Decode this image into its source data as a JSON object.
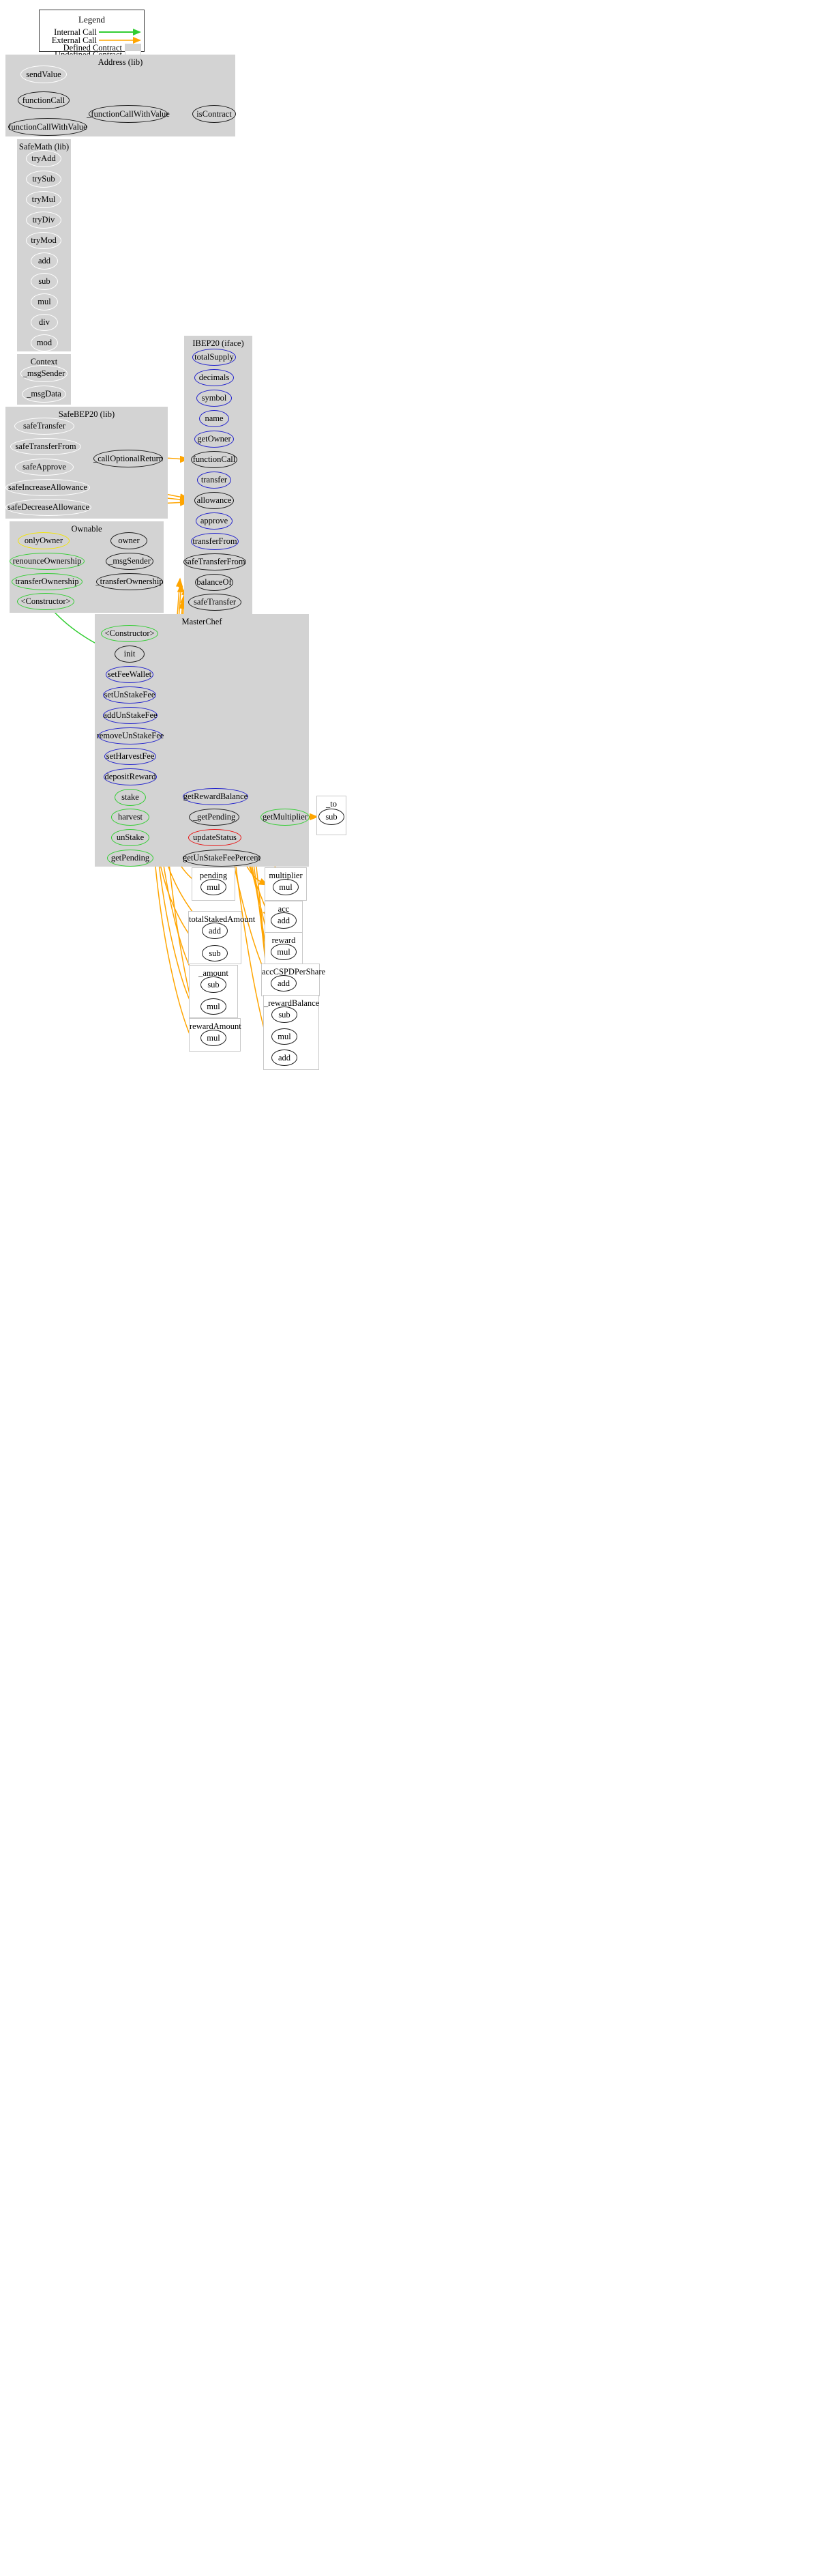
{
  "legend": {
    "title": "Legend",
    "rows": [
      {
        "label": "Internal Call",
        "kind": "arrow",
        "color": "#32cd32"
      },
      {
        "label": "External Call",
        "kind": "arrow",
        "color": "#ffa500"
      },
      {
        "label": "Defined Contract",
        "kind": "swatch-filled",
        "color": "#d3d3d3"
      },
      {
        "label": "Undefined Contract",
        "kind": "swatch-empty",
        "color": "#ffffff"
      }
    ]
  },
  "colors": {
    "internal_call": "#32cd32",
    "external_call": "#ffa500",
    "defined_contract_fill": "#d3d3d3",
    "undefined_contract_fill": "#ffffff",
    "node_undefined": "#ffffff",
    "node_defined": "#1a1a1a",
    "node_interface": "#2222cc",
    "node_public": "#32cd32",
    "node_modifier": "#f2e500",
    "node_warning": "#e81414"
  },
  "clusters": [
    {
      "id": "address",
      "title": "Address  (lib)",
      "defined": true,
      "nodes": [
        {
          "id": "addr_sendValue",
          "label": "sendValue",
          "style": "n-white"
        },
        {
          "id": "addr_functionCall",
          "label": "functionCall",
          "style": "n-black"
        },
        {
          "id": "addr_functionCallWithValue",
          "label": "functionCallWithValue",
          "style": "n-black"
        },
        {
          "id": "addr__functionCallWithValue",
          "label": "_functionCallWithValue",
          "style": "n-black"
        },
        {
          "id": "addr_isContract",
          "label": "isContract",
          "style": "n-black"
        }
      ]
    },
    {
      "id": "safemath",
      "title": "SafeMath  (lib)",
      "defined": true,
      "nodes": [
        {
          "id": "sm_tryAdd",
          "label": "tryAdd",
          "style": "n-white"
        },
        {
          "id": "sm_trySub",
          "label": "trySub",
          "style": "n-white"
        },
        {
          "id": "sm_tryMul",
          "label": "tryMul",
          "style": "n-white"
        },
        {
          "id": "sm_tryDiv",
          "label": "tryDiv",
          "style": "n-white"
        },
        {
          "id": "sm_tryMod",
          "label": "tryMod",
          "style": "n-white"
        },
        {
          "id": "sm_add",
          "label": "add",
          "style": "n-white"
        },
        {
          "id": "sm_sub",
          "label": "sub",
          "style": "n-white"
        },
        {
          "id": "sm_mul",
          "label": "mul",
          "style": "n-white"
        },
        {
          "id": "sm_div",
          "label": "div",
          "style": "n-white"
        },
        {
          "id": "sm_mod",
          "label": "mod",
          "style": "n-white"
        }
      ]
    },
    {
      "id": "context",
      "title": "Context",
      "defined": true,
      "nodes": [
        {
          "id": "ctx__msgSender",
          "label": "_msgSender",
          "style": "n-white"
        },
        {
          "id": "ctx__msgData",
          "label": "_msgData",
          "style": "n-white"
        }
      ]
    },
    {
      "id": "safebep20",
      "title": "SafeBEP20  (lib)",
      "defined": true,
      "nodes": [
        {
          "id": "sb_safeTransfer",
          "label": "safeTransfer",
          "style": "n-white"
        },
        {
          "id": "sb_safeTransferFrom",
          "label": "safeTransferFrom",
          "style": "n-white"
        },
        {
          "id": "sb_safeApprove",
          "label": "safeApprove",
          "style": "n-white"
        },
        {
          "id": "sb_safeIncreaseAllowance",
          "label": "safeIncreaseAllowance",
          "style": "n-white"
        },
        {
          "id": "sb_safeDecreaseAllowance",
          "label": "safeDecreaseAllowance",
          "style": "n-white"
        },
        {
          "id": "sb__callOptionalReturn",
          "label": "_callOptionalReturn",
          "style": "n-black"
        }
      ]
    },
    {
      "id": "ibep20",
      "title": "IBEP20  (iface)",
      "defined": true,
      "nodes": [
        {
          "id": "ib_totalSupply",
          "label": "totalSupply",
          "style": "n-blue"
        },
        {
          "id": "ib_decimals",
          "label": "decimals",
          "style": "n-blue"
        },
        {
          "id": "ib_symbol",
          "label": "symbol",
          "style": "n-blue"
        },
        {
          "id": "ib_name",
          "label": "name",
          "style": "n-blue"
        },
        {
          "id": "ib_getOwner",
          "label": "getOwner",
          "style": "n-blue"
        },
        {
          "id": "ib_functionCall",
          "label": "functionCall",
          "style": "n-black"
        },
        {
          "id": "ib_transfer",
          "label": "transfer",
          "style": "n-blue"
        },
        {
          "id": "ib_allowance",
          "label": "allowance",
          "style": "n-black"
        },
        {
          "id": "ib_approve",
          "label": "approve",
          "style": "n-blue"
        },
        {
          "id": "ib_transferFrom",
          "label": "transferFrom",
          "style": "n-blue"
        },
        {
          "id": "ib_safeTransferFrom",
          "label": "safeTransferFrom",
          "style": "n-black"
        },
        {
          "id": "ib_balanceOf",
          "label": "balanceOf",
          "style": "n-black"
        },
        {
          "id": "ib_safeTransfer",
          "label": "safeTransfer",
          "style": "n-black"
        }
      ]
    },
    {
      "id": "ownable",
      "title": "Ownable",
      "defined": true,
      "nodes": [
        {
          "id": "ow_onlyOwner",
          "label": "onlyOwner",
          "style": "n-yellow"
        },
        {
          "id": "ow_renounceOwnership",
          "label": "renounceOwnership",
          "style": "n-green"
        },
        {
          "id": "ow_transferOwnership",
          "label": "transferOwnership",
          "style": "n-green"
        },
        {
          "id": "ow_constructor",
          "label": "<Constructor>",
          "style": "n-green"
        },
        {
          "id": "ow_owner",
          "label": "owner",
          "style": "n-black"
        },
        {
          "id": "ow__msgSender",
          "label": "_msgSender",
          "style": "n-black"
        },
        {
          "id": "ow__transferOwnership",
          "label": "_transferOwnership",
          "style": "n-black"
        }
      ]
    },
    {
      "id": "masterchef",
      "title": "MasterChef",
      "defined": true,
      "nodes": [
        {
          "id": "mc_constructor",
          "label": "<Constructor>",
          "style": "n-green"
        },
        {
          "id": "mc_init",
          "label": "init",
          "style": "n-black"
        },
        {
          "id": "mc_setFeeWallet",
          "label": "setFeeWallet",
          "style": "n-blue"
        },
        {
          "id": "mc_setUnStakeFee",
          "label": "setUnStakeFee",
          "style": "n-blue"
        },
        {
          "id": "mc_addUnStakeFee",
          "label": "addUnStakeFee",
          "style": "n-blue"
        },
        {
          "id": "mc_removeUnStakeFee",
          "label": "removeUnStakeFee",
          "style": "n-blue"
        },
        {
          "id": "mc_setHarvestFee",
          "label": "setHarvestFee",
          "style": "n-blue"
        },
        {
          "id": "mc_depositReward",
          "label": "depositReward",
          "style": "n-blue"
        },
        {
          "id": "mc_stake",
          "label": "stake",
          "style": "n-green"
        },
        {
          "id": "mc_harvest",
          "label": "harvest",
          "style": "n-green"
        },
        {
          "id": "mc_unStake",
          "label": "unStake",
          "style": "n-green"
        },
        {
          "id": "mc_getPending",
          "label": "getPending",
          "style": "n-green"
        },
        {
          "id": "mc_getRewardBalance",
          "label": "getRewardBalance",
          "style": "n-blue"
        },
        {
          "id": "mc__getPending",
          "label": "_getPending",
          "style": "n-black"
        },
        {
          "id": "mc_updateStatus",
          "label": "updateStatus",
          "style": "n-red"
        },
        {
          "id": "mc_getUnStakeFeePercent",
          "label": "getUnStakeFeePercent",
          "style": "n-black"
        },
        {
          "id": "mc_getMultiplier",
          "label": "getMultiplier",
          "style": "n-green"
        }
      ]
    },
    {
      "id": "to",
      "title": "_to",
      "defined": false,
      "nodes": [
        {
          "id": "to_sub",
          "label": "sub",
          "style": "n-black"
        }
      ]
    },
    {
      "id": "pending",
      "title": "pending",
      "defined": false,
      "nodes": [
        {
          "id": "pending_mul",
          "label": "mul",
          "style": "n-black"
        }
      ]
    },
    {
      "id": "multiplier",
      "title": "multiplier",
      "defined": false,
      "nodes": [
        {
          "id": "multiplier_mul",
          "label": "mul",
          "style": "n-black"
        }
      ]
    },
    {
      "id": "acc",
      "title": "acc",
      "defined": false,
      "nodes": [
        {
          "id": "acc_add",
          "label": "add",
          "style": "n-black"
        }
      ]
    },
    {
      "id": "totalStakedAmount",
      "title": "totalStakedAmount",
      "defined": false,
      "nodes": [
        {
          "id": "tsa_add",
          "label": "add",
          "style": "n-black"
        },
        {
          "id": "tsa_sub",
          "label": "sub",
          "style": "n-black"
        }
      ]
    },
    {
      "id": "reward",
      "title": "reward",
      "defined": false,
      "nodes": [
        {
          "id": "reward_mul",
          "label": "mul",
          "style": "n-black"
        }
      ]
    },
    {
      "id": "accCSPDPerShare",
      "title": "accCSPDPerShare",
      "defined": false,
      "nodes": [
        {
          "id": "accshare_add",
          "label": "add",
          "style": "n-black"
        }
      ]
    },
    {
      "id": "amount",
      "title": "_amount",
      "defined": false,
      "nodes": [
        {
          "id": "amount_sub",
          "label": "sub",
          "style": "n-black"
        },
        {
          "id": "amount_mul",
          "label": "mul",
          "style": "n-black"
        }
      ]
    },
    {
      "id": "rewardBalance",
      "title": "_rewardBalance",
      "defined": false,
      "nodes": [
        {
          "id": "rb_sub",
          "label": "sub",
          "style": "n-black"
        },
        {
          "id": "rb_mul",
          "label": "mul",
          "style": "n-black"
        },
        {
          "id": "rb_add",
          "label": "add",
          "style": "n-black"
        }
      ]
    },
    {
      "id": "rewardAmount",
      "title": "rewardAmount",
      "defined": false,
      "nodes": [
        {
          "id": "ra_mul",
          "label": "mul",
          "style": "n-black"
        }
      ]
    }
  ]
}
